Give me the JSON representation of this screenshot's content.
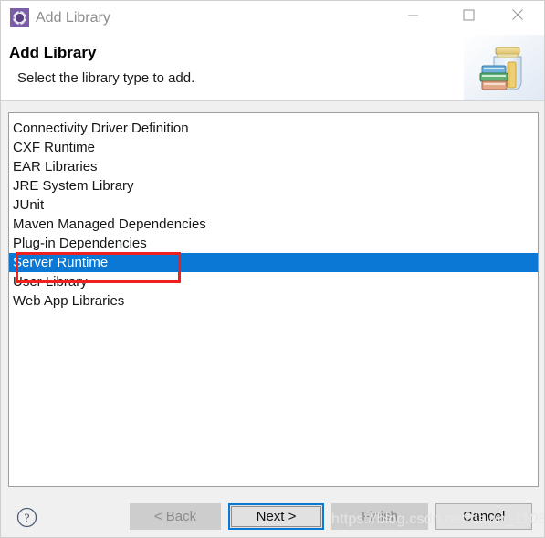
{
  "window": {
    "title": "Add Library",
    "icon": "eclipse-gear-icon",
    "controls": {
      "minimize": "minimize-icon",
      "maximize": "maximize-icon",
      "close": "close-icon"
    }
  },
  "header": {
    "title": "Add Library",
    "description": "Select the library type to add.",
    "banner_icon": "library-jar-books-icon"
  },
  "list": {
    "items": [
      {
        "label": "Connectivity Driver Definition",
        "selected": false
      },
      {
        "label": "CXF Runtime",
        "selected": false
      },
      {
        "label": "EAR Libraries",
        "selected": false
      },
      {
        "label": "JRE System Library",
        "selected": false
      },
      {
        "label": "JUnit",
        "selected": false
      },
      {
        "label": "Maven Managed Dependencies",
        "selected": false
      },
      {
        "label": "Plug-in Dependencies",
        "selected": false
      },
      {
        "label": "Server Runtime",
        "selected": true
      },
      {
        "label": "User Library",
        "selected": false
      },
      {
        "label": "Web App Libraries",
        "selected": false
      }
    ],
    "selected_label": "Server Runtime"
  },
  "annotation": {
    "shape": "rectangle",
    "color": "#f02020",
    "targets": "Server Runtime"
  },
  "footer": {
    "help_icon": "help-question-icon",
    "buttons": [
      {
        "label": "< Back",
        "state": "disabled"
      },
      {
        "label": "Next >",
        "state": "focused"
      },
      {
        "label": "Finish",
        "state": "disabled"
      },
      {
        "label": "Cancel",
        "state": "enabled"
      }
    ],
    "back_label": "< Back",
    "next_label": "Next >",
    "finish_label": "Finish",
    "cancel_label": "Cancel"
  },
  "watermark": {
    "text": "https://blog.csdn.net/dawn_1108"
  },
  "colors": {
    "selection": "#0a78d4",
    "annotation": "#f02020",
    "dialog_background": "#f0f0f0",
    "panel_background": "#ffffff"
  }
}
